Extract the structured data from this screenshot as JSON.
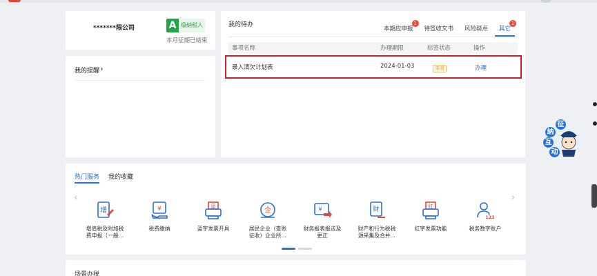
{
  "company": {
    "name": "*******限公司",
    "grade_letter": "A",
    "grade_text": "级纳税人",
    "period_status": "本月征期已结束"
  },
  "reminder": {
    "title": "我的提醒",
    "chevron": "›"
  },
  "todo": {
    "title": "我的待办",
    "tabs": [
      {
        "label": "本期应申报",
        "badge": "1",
        "active": false
      },
      {
        "label": "待签收文书",
        "badge": "",
        "active": false
      },
      {
        "label": "风险疑点",
        "badge": "",
        "active": false
      },
      {
        "label": "其它",
        "badge": "1",
        "active": true
      }
    ],
    "columns": [
      "事项名称",
      "办理期限",
      "标签状态",
      "操作"
    ],
    "rows": [
      {
        "name": "录入清欠计划表",
        "deadline": "2024-01-03",
        "status": "未阅",
        "action": "办理"
      }
    ]
  },
  "services": {
    "tabs": [
      {
        "label": "热门服务",
        "active": true
      },
      {
        "label": "我的收藏",
        "active": false
      }
    ],
    "items": [
      {
        "icon": "vat-return-icon",
        "label_lines": [
          "增值税及附加税",
          "费申报（一般..."
        ]
      },
      {
        "icon": "fee-payment-icon",
        "label_lines": [
          "税费缴纳"
        ]
      },
      {
        "icon": "blue-invoice-icon",
        "label_lines": [
          "蓝字发票开具"
        ]
      },
      {
        "icon": "enterprise-tax-icon",
        "label_lines": [
          "居民企业（查账",
          "征收）企业所..."
        ]
      },
      {
        "icon": "financial-report-icon",
        "label_lines": [
          "财务报表报送及",
          "更正"
        ]
      },
      {
        "icon": "property-tax-icon",
        "label_lines": [
          "财产和行为税税",
          "源采集及合并..."
        ]
      },
      {
        "icon": "red-invoice-icon",
        "label_lines": [
          "红字发票功能"
        ]
      },
      {
        "icon": "tax-account-icon",
        "label_lines": [
          "税务数字账户"
        ]
      }
    ],
    "prev_arrow": "‹",
    "next_arrow": "›"
  },
  "scene": {
    "title": "场景办税"
  },
  "assistant": {
    "chars": [
      "征",
      "纳",
      "互",
      "动"
    ]
  },
  "colors": {
    "primary": "#2b70d9",
    "highlight": "#c8212b",
    "badge": "#e64a3b",
    "grade": "#22a447",
    "pending": "#e6a23c"
  }
}
